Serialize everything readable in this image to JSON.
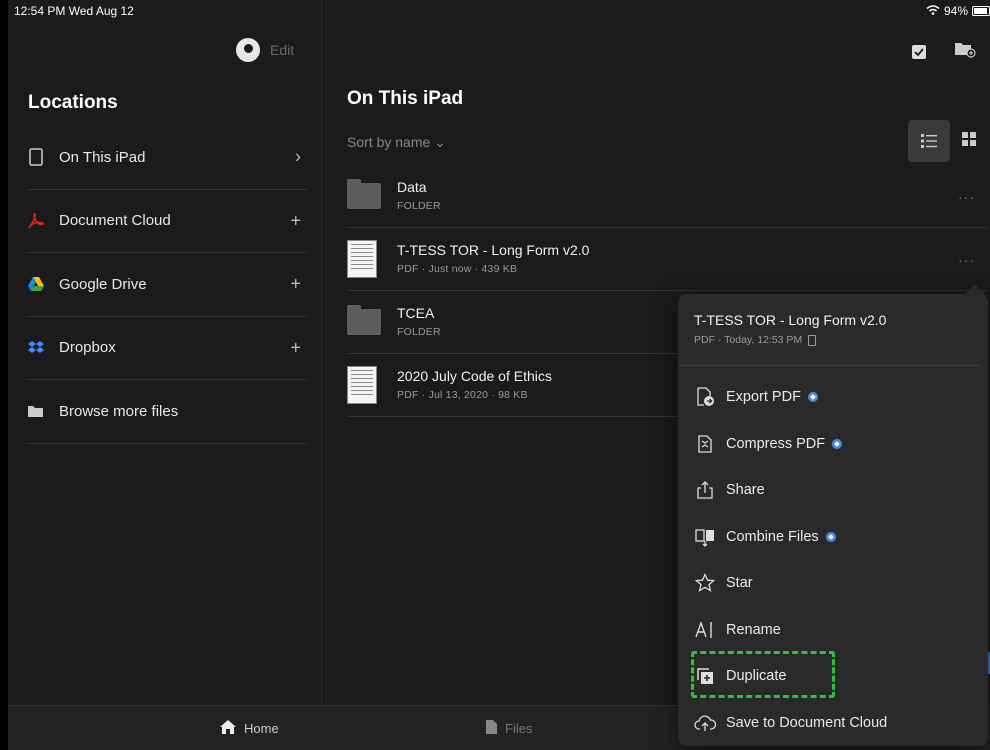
{
  "status_bar": {
    "time": "12:54 PM  Wed Aug 12",
    "battery": "94%"
  },
  "sidebar": {
    "edit_label": "Edit",
    "title": "Locations",
    "items": [
      {
        "label": "On This iPad",
        "icon": "tablet-icon",
        "action": "›"
      },
      {
        "label": "Document Cloud",
        "icon": "acrobat-icon",
        "action": "+"
      },
      {
        "label": "Google Drive",
        "icon": "google-drive-icon",
        "action": "+"
      },
      {
        "label": "Dropbox",
        "icon": "dropbox-icon",
        "action": "+"
      },
      {
        "label": "Browse more files",
        "icon": "folder-open-icon",
        "action": ""
      }
    ]
  },
  "main": {
    "title": "On This iPad",
    "sort_label": "Sort by name ⌄",
    "files": [
      {
        "name": "Data",
        "meta": "FOLDER",
        "type": "folder"
      },
      {
        "name": "T-TESS TOR - Long Form v2.0",
        "meta": "PDF  ·  Just now  ·  439 KB",
        "type": "pdf"
      },
      {
        "name": "TCEA",
        "meta": "FOLDER",
        "type": "folder"
      },
      {
        "name": "2020 July Code of Ethics",
        "meta": "PDF  ·  Jul 13, 2020  ·  98 KB",
        "type": "pdf"
      }
    ],
    "more_label": "···"
  },
  "popover": {
    "title": "T-TESS TOR - Long Form v2.0",
    "meta": "PDF  ·  Today, 12:53 PM",
    "items": [
      {
        "label": "Export PDF",
        "premium": true,
        "icon": "export-pdf-icon"
      },
      {
        "label": "Compress PDF",
        "premium": true,
        "icon": "compress-pdf-icon"
      },
      {
        "label": "Share",
        "premium": false,
        "icon": "share-icon"
      },
      {
        "label": "Combine Files",
        "premium": true,
        "icon": "combine-files-icon"
      },
      {
        "label": "Star",
        "premium": false,
        "icon": "star-icon"
      },
      {
        "label": "Rename",
        "premium": false,
        "icon": "rename-icon"
      },
      {
        "label": "Duplicate",
        "premium": false,
        "icon": "duplicate-icon"
      },
      {
        "label": "Save to Document Cloud",
        "premium": false,
        "icon": "cloud-upload-icon"
      }
    ]
  },
  "tabbar": {
    "home": "Home",
    "files": "Files"
  },
  "colors": {
    "accent_blue": "#4a8cf0",
    "highlight_green": "#2ec23a",
    "acrobat_red": "#e2231a"
  }
}
